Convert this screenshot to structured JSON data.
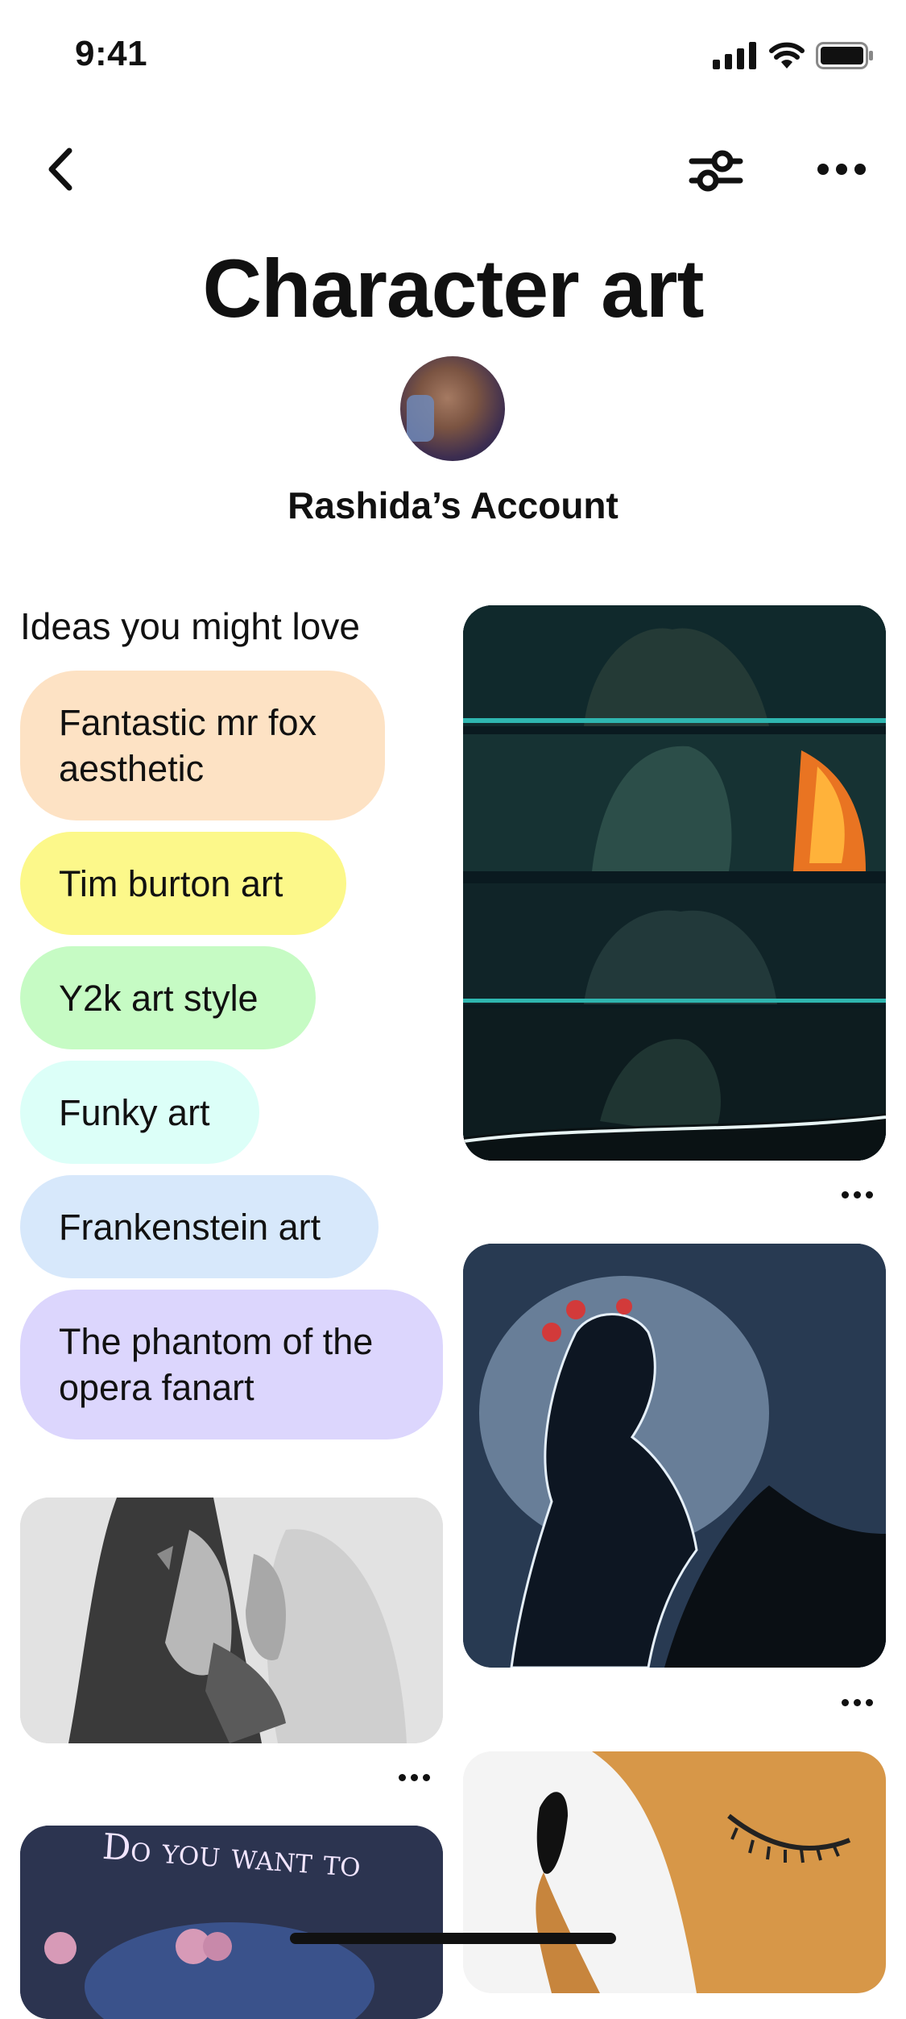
{
  "status_bar": {
    "time": "9:41"
  },
  "board": {
    "title": "Character art",
    "owner": "Rashida’s Account"
  },
  "ideas": {
    "heading": "Ideas you might love",
    "chips": [
      {
        "line1": "Fantastic mr fox",
        "line2": "aesthetic",
        "color": "#fde2c4"
      },
      {
        "line1": "Tim burton art",
        "line2": "",
        "color": "#fcf88a"
      },
      {
        "line1": "Y2k art style",
        "line2": "",
        "color": "#c6fbc4"
      },
      {
        "line1": "Funky art",
        "line2": "",
        "color": "#dcfff8"
      },
      {
        "line1": "Frankenstein art",
        "line2": "",
        "color": "#d7e8fb"
      },
      {
        "line1": "The phantom of the",
        "line2": "opera fanart",
        "color": "#dcd6fd"
      }
    ]
  },
  "pins": {
    "poster_text": "Do you want to"
  },
  "icons": {
    "back": "chevron-left-icon",
    "filter": "filter-sliders-icon",
    "more": "ellipsis-icon"
  }
}
